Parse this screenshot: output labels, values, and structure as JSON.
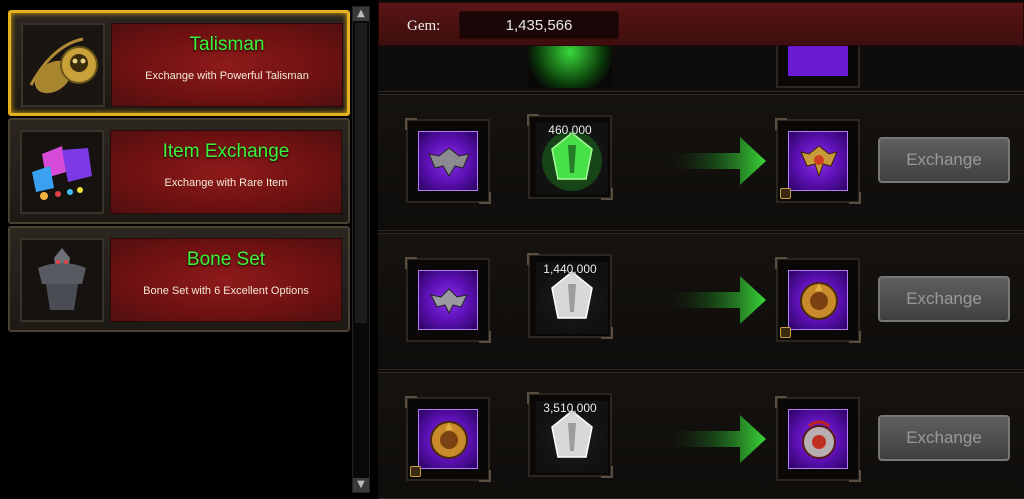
{
  "categories": [
    {
      "title": "Talisman",
      "description": "Exchange with Powerful Talisman",
      "selected": true,
      "icon": "talisman-icon"
    },
    {
      "title": "Item Exchange",
      "description": "Exchange with Rare Item",
      "selected": false,
      "icon": "gems-pile-icon"
    },
    {
      "title": "Bone Set",
      "description": "Bone Set with 6 Excellent Options",
      "selected": false,
      "icon": "bone-armor-icon"
    }
  ],
  "gem": {
    "label": "Gem:",
    "value": "1,435,566"
  },
  "exchanges": [
    {
      "cost": "460,000",
      "gem_color": "green",
      "input_icon": "winged-emblem-icon",
      "output_icon": "talisman-crest-icon",
      "button": "Exchange"
    },
    {
      "cost": "1,440,000",
      "gem_color": "white",
      "input_icon": "winged-emblem-icon",
      "output_icon": "talisman-medallion-icon",
      "button": "Exchange"
    },
    {
      "cost": "3,510,000",
      "gem_color": "white",
      "input_icon": "talisman-medallion-icon",
      "output_icon": "talisman-orb-icon",
      "button": "Exchange"
    }
  ],
  "colors": {
    "accent_gold": "#e4b21e",
    "title_green": "#3df23a",
    "panel_red": "#7a1414",
    "rare_purple": "#7a22e0"
  }
}
